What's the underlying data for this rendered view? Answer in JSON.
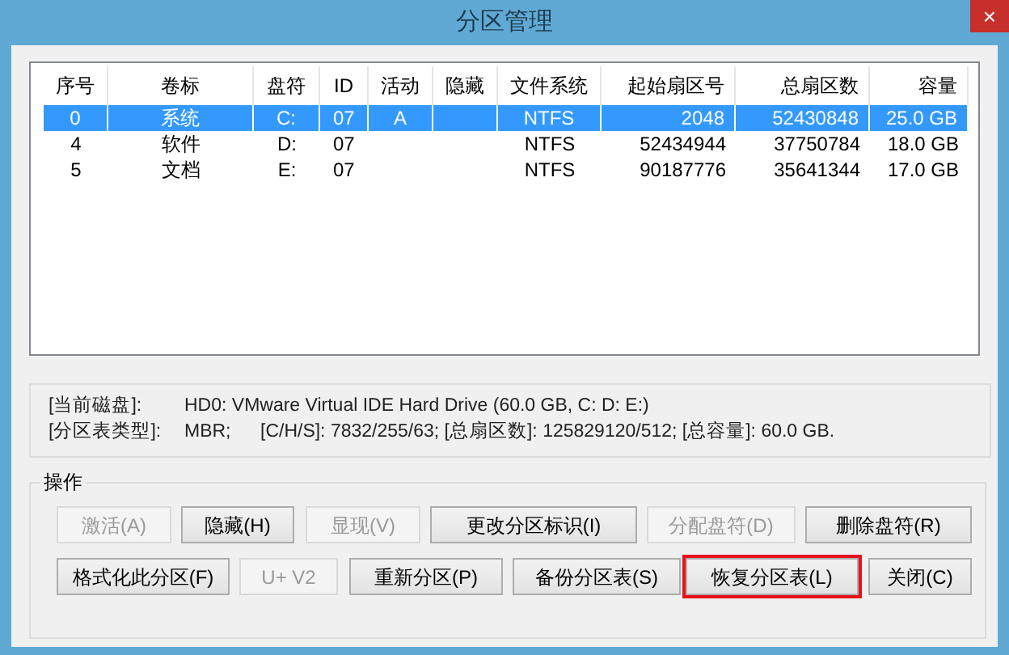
{
  "window": {
    "title": "分区管理",
    "close": "×"
  },
  "table": {
    "columns": [
      "序号",
      "卷标",
      "盘符",
      "ID",
      "活动",
      "隐藏",
      "文件系统",
      "起始扇区号",
      "总扇区数",
      "容量"
    ],
    "rows": [
      {
        "selected": true,
        "cells": [
          "0",
          "系统",
          "C:",
          "07",
          "A",
          "",
          "NTFS",
          "2048",
          "52430848",
          "25.0 GB"
        ]
      },
      {
        "selected": false,
        "cells": [
          "4",
          "软件",
          "D:",
          "07",
          "",
          "",
          "NTFS",
          "52434944",
          "37750784",
          "18.0 GB"
        ]
      },
      {
        "selected": false,
        "cells": [
          "5",
          "文档",
          "E:",
          "07",
          "",
          "",
          "NTFS",
          "90187776",
          "35641344",
          "17.0 GB"
        ]
      }
    ]
  },
  "disk_info": [
    {
      "label": "[当前磁盘]:",
      "value": "HD0: VMware Virtual IDE Hard Drive (60.0 GB, C: D: E:)"
    },
    {
      "label": "[分区表类型]:",
      "value": "MBR;",
      "extra": "[C/H/S]: 7832/255/63; [总扇区数]: 125829120/512; [总容量]: 60.0 GB."
    }
  ],
  "operations": {
    "title": "操作",
    "rows": [
      [
        {
          "label": "激活(A)",
          "disabled": true,
          "focused": false
        },
        {
          "label": "隐藏(H)",
          "disabled": false,
          "focused": false
        },
        {
          "label": "显现(V)",
          "disabled": true,
          "focused": false
        },
        {
          "label": "更改分区标识(I)",
          "disabled": false,
          "focused": false
        },
        {
          "label": "分配盘符(D)",
          "disabled": true,
          "focused": false
        },
        {
          "label": "删除盘符(R)",
          "disabled": false,
          "focused": false
        }
      ],
      [
        {
          "label": "格式化此分区(F)",
          "disabled": false,
          "focused": false
        },
        {
          "label": "U+ V2",
          "disabled": true,
          "focused": false
        },
        {
          "label": "重新分区(P)",
          "disabled": false,
          "focused": false
        },
        {
          "label": "备份分区表(S)",
          "disabled": false,
          "focused": false
        },
        {
          "label": "恢复分区表(L)",
          "disabled": false,
          "focused": true
        },
        {
          "label": "关闭(C)",
          "disabled": false,
          "focused": false
        }
      ]
    ]
  }
}
